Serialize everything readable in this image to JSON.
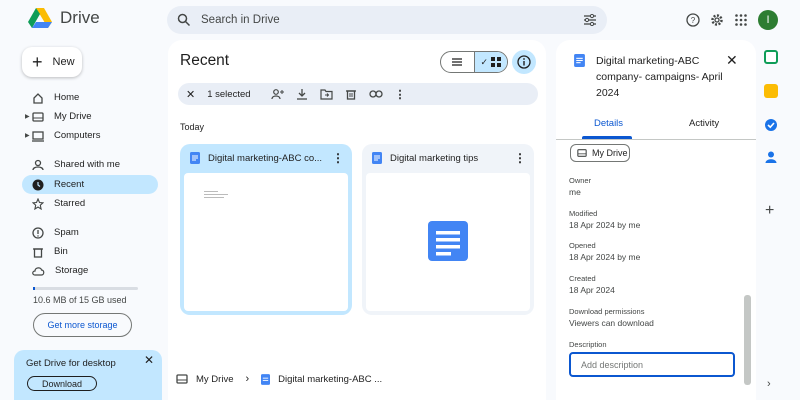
{
  "app": {
    "name": "Drive",
    "avatar_letter": "I"
  },
  "search": {
    "placeholder": "Search in Drive"
  },
  "sidebar": {
    "new_label": "New",
    "items": [
      {
        "label": "Home",
        "icon": "home-icon"
      },
      {
        "label": "My Drive",
        "icon": "drive-icon"
      },
      {
        "label": "Computers",
        "icon": "computer-icon"
      },
      {
        "label": "Shared with me",
        "icon": "people-icon"
      },
      {
        "label": "Recent",
        "icon": "clock-icon"
      },
      {
        "label": "Starred",
        "icon": "star-icon"
      },
      {
        "label": "Spam",
        "icon": "spam-icon"
      },
      {
        "label": "Bin",
        "icon": "bin-icon"
      },
      {
        "label": "Storage",
        "icon": "cloud-icon"
      }
    ],
    "storage_text": "10.6 MB of 15 GB used",
    "storage_fraction": 0.0007,
    "get_storage_label": "Get more storage",
    "promo": {
      "title": "Get Drive for desktop",
      "button": "Download"
    }
  },
  "main": {
    "title": "Recent",
    "selection": {
      "count_label": "1 selected"
    },
    "section": "Today",
    "files": [
      {
        "name": "Digital marketing-ABC co...",
        "selected": true
      },
      {
        "name": "Digital marketing tips",
        "selected": false
      }
    ],
    "breadcrumb": {
      "root": "My Drive",
      "file": "Digital marketing-ABC ..."
    }
  },
  "details": {
    "title": "Digital marketing-ABC company- campaigns- April 2024",
    "tabs": [
      "Details",
      "Activity"
    ],
    "location_chip": "My Drive",
    "fields": [
      {
        "label": "Owner",
        "value": "me"
      },
      {
        "label": "Modified",
        "value": "18 Apr 2024 by me"
      },
      {
        "label": "Opened",
        "value": "18 Apr 2024 by me"
      },
      {
        "label": "Created",
        "value": "18 Apr 2024"
      },
      {
        "label": "Download permissions",
        "value": "Viewers can download"
      }
    ],
    "description_label": "Description",
    "description_placeholder": "Add description"
  },
  "colors": {
    "accent": "#0b57d0",
    "selected_bg": "#c2e7ff",
    "surface": "#f8fafd"
  }
}
